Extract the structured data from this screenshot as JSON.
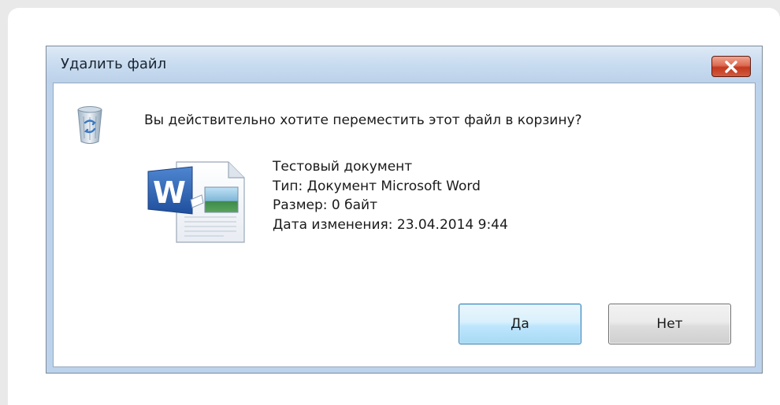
{
  "dialog": {
    "title": "Удалить файл",
    "close_icon": "close-icon",
    "recycle_icon": "recycle-bin-icon",
    "question": "Вы действительно хотите переместить этот файл в корзину?",
    "file": {
      "icon": "word-document-icon",
      "name": "Тестовый документ",
      "type": "Тип: Документ Microsoft Word",
      "size": "Размер: 0 байт",
      "modified": "Дата изменения: 23.04.2014 9:44"
    },
    "buttons": {
      "yes_label": "Да",
      "no_label": "Нет"
    },
    "colors": {
      "close_button": "#c2391f",
      "frame": "#bcd3eb",
      "default_button": "#bee6fd"
    }
  }
}
